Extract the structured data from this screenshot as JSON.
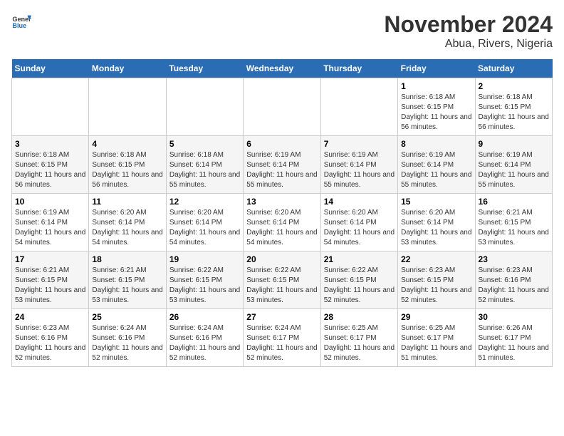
{
  "header": {
    "logo_line1": "General",
    "logo_line2": "Blue",
    "title": "November 2024",
    "subtitle": "Abua, Rivers, Nigeria"
  },
  "weekdays": [
    "Sunday",
    "Monday",
    "Tuesday",
    "Wednesday",
    "Thursday",
    "Friday",
    "Saturday"
  ],
  "weeks": [
    [
      {
        "day": "",
        "info": ""
      },
      {
        "day": "",
        "info": ""
      },
      {
        "day": "",
        "info": ""
      },
      {
        "day": "",
        "info": ""
      },
      {
        "day": "",
        "info": ""
      },
      {
        "day": "1",
        "info": "Sunrise: 6:18 AM\nSunset: 6:15 PM\nDaylight: 11 hours and 56 minutes."
      },
      {
        "day": "2",
        "info": "Sunrise: 6:18 AM\nSunset: 6:15 PM\nDaylight: 11 hours and 56 minutes."
      }
    ],
    [
      {
        "day": "3",
        "info": "Sunrise: 6:18 AM\nSunset: 6:15 PM\nDaylight: 11 hours and 56 minutes."
      },
      {
        "day": "4",
        "info": "Sunrise: 6:18 AM\nSunset: 6:15 PM\nDaylight: 11 hours and 56 minutes."
      },
      {
        "day": "5",
        "info": "Sunrise: 6:18 AM\nSunset: 6:14 PM\nDaylight: 11 hours and 55 minutes."
      },
      {
        "day": "6",
        "info": "Sunrise: 6:19 AM\nSunset: 6:14 PM\nDaylight: 11 hours and 55 minutes."
      },
      {
        "day": "7",
        "info": "Sunrise: 6:19 AM\nSunset: 6:14 PM\nDaylight: 11 hours and 55 minutes."
      },
      {
        "day": "8",
        "info": "Sunrise: 6:19 AM\nSunset: 6:14 PM\nDaylight: 11 hours and 55 minutes."
      },
      {
        "day": "9",
        "info": "Sunrise: 6:19 AM\nSunset: 6:14 PM\nDaylight: 11 hours and 55 minutes."
      }
    ],
    [
      {
        "day": "10",
        "info": "Sunrise: 6:19 AM\nSunset: 6:14 PM\nDaylight: 11 hours and 54 minutes."
      },
      {
        "day": "11",
        "info": "Sunrise: 6:20 AM\nSunset: 6:14 PM\nDaylight: 11 hours and 54 minutes."
      },
      {
        "day": "12",
        "info": "Sunrise: 6:20 AM\nSunset: 6:14 PM\nDaylight: 11 hours and 54 minutes."
      },
      {
        "day": "13",
        "info": "Sunrise: 6:20 AM\nSunset: 6:14 PM\nDaylight: 11 hours and 54 minutes."
      },
      {
        "day": "14",
        "info": "Sunrise: 6:20 AM\nSunset: 6:14 PM\nDaylight: 11 hours and 54 minutes."
      },
      {
        "day": "15",
        "info": "Sunrise: 6:20 AM\nSunset: 6:14 PM\nDaylight: 11 hours and 53 minutes."
      },
      {
        "day": "16",
        "info": "Sunrise: 6:21 AM\nSunset: 6:15 PM\nDaylight: 11 hours and 53 minutes."
      }
    ],
    [
      {
        "day": "17",
        "info": "Sunrise: 6:21 AM\nSunset: 6:15 PM\nDaylight: 11 hours and 53 minutes."
      },
      {
        "day": "18",
        "info": "Sunrise: 6:21 AM\nSunset: 6:15 PM\nDaylight: 11 hours and 53 minutes."
      },
      {
        "day": "19",
        "info": "Sunrise: 6:22 AM\nSunset: 6:15 PM\nDaylight: 11 hours and 53 minutes."
      },
      {
        "day": "20",
        "info": "Sunrise: 6:22 AM\nSunset: 6:15 PM\nDaylight: 11 hours and 53 minutes."
      },
      {
        "day": "21",
        "info": "Sunrise: 6:22 AM\nSunset: 6:15 PM\nDaylight: 11 hours and 52 minutes."
      },
      {
        "day": "22",
        "info": "Sunrise: 6:23 AM\nSunset: 6:15 PM\nDaylight: 11 hours and 52 minutes."
      },
      {
        "day": "23",
        "info": "Sunrise: 6:23 AM\nSunset: 6:16 PM\nDaylight: 11 hours and 52 minutes."
      }
    ],
    [
      {
        "day": "24",
        "info": "Sunrise: 6:23 AM\nSunset: 6:16 PM\nDaylight: 11 hours and 52 minutes."
      },
      {
        "day": "25",
        "info": "Sunrise: 6:24 AM\nSunset: 6:16 PM\nDaylight: 11 hours and 52 minutes."
      },
      {
        "day": "26",
        "info": "Sunrise: 6:24 AM\nSunset: 6:16 PM\nDaylight: 11 hours and 52 minutes."
      },
      {
        "day": "27",
        "info": "Sunrise: 6:24 AM\nSunset: 6:17 PM\nDaylight: 11 hours and 52 minutes."
      },
      {
        "day": "28",
        "info": "Sunrise: 6:25 AM\nSunset: 6:17 PM\nDaylight: 11 hours and 52 minutes."
      },
      {
        "day": "29",
        "info": "Sunrise: 6:25 AM\nSunset: 6:17 PM\nDaylight: 11 hours and 51 minutes."
      },
      {
        "day": "30",
        "info": "Sunrise: 6:26 AM\nSunset: 6:17 PM\nDaylight: 11 hours and 51 minutes."
      }
    ]
  ]
}
